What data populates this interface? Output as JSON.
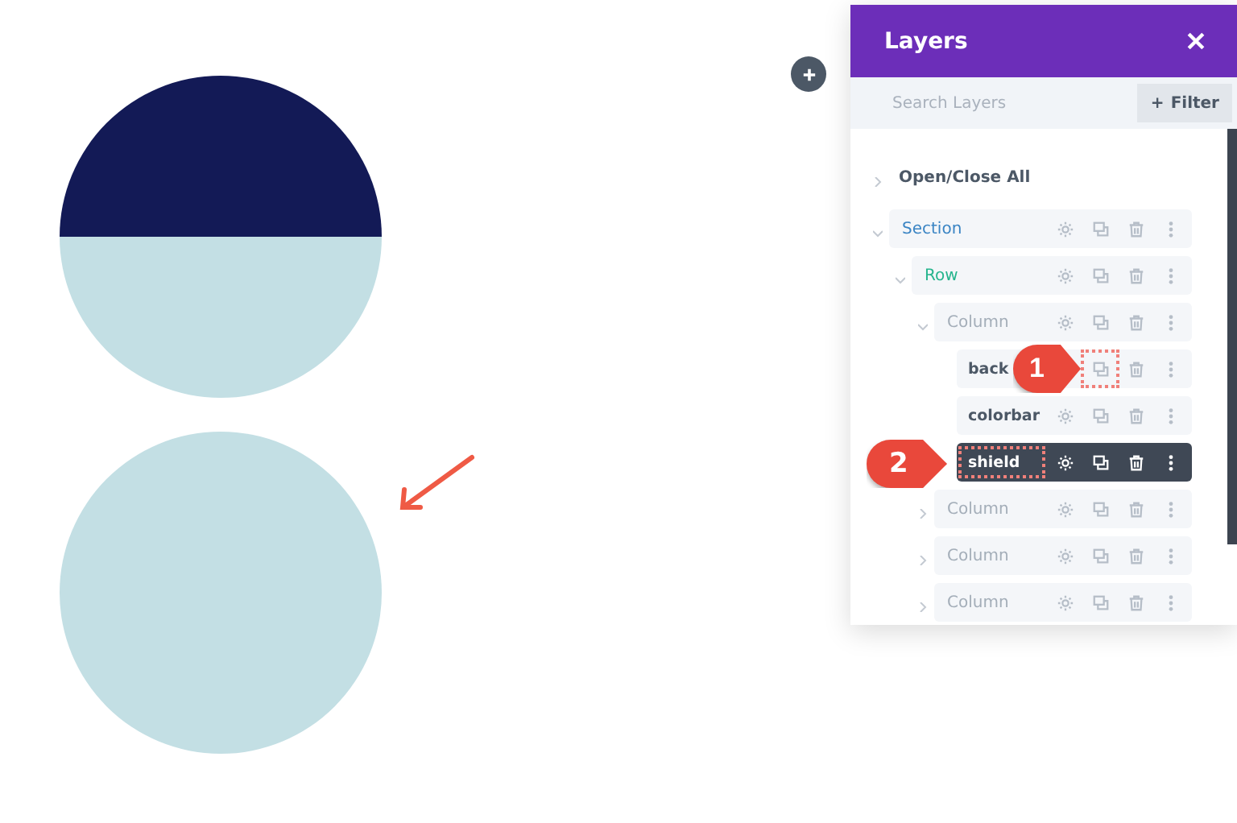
{
  "panel": {
    "title": "Layers",
    "search": {
      "placeholder": "Search Layers"
    },
    "filter_button": {
      "icon": "+",
      "label": "Filter"
    },
    "toggle_all": {
      "label": "Open/Close All",
      "expanded": false
    },
    "tree": [
      {
        "kind": "section",
        "label": "Section",
        "expanded": true,
        "selected": false,
        "children": [
          {
            "kind": "row",
            "label": "Row",
            "expanded": true,
            "selected": false,
            "children": [
              {
                "kind": "column",
                "label": "Column",
                "expanded": true,
                "selected": false,
                "children": [
                  {
                    "kind": "module",
                    "label": "back",
                    "selected": false,
                    "callout": {
                      "number": "1",
                      "kind": "duplicate"
                    }
                  },
                  {
                    "kind": "module",
                    "label": "colorbar",
                    "selected": false
                  },
                  {
                    "kind": "module",
                    "label": "shield",
                    "selected": true,
                    "callout": {
                      "number": "2",
                      "kind": "label"
                    }
                  }
                ]
              },
              {
                "kind": "column",
                "label": "Column",
                "expanded": false,
                "selected": false
              },
              {
                "kind": "column",
                "label": "Column",
                "expanded": false,
                "selected": false
              },
              {
                "kind": "column",
                "label": "Column",
                "expanded": false,
                "selected": false
              }
            ]
          }
        ]
      }
    ]
  }
}
